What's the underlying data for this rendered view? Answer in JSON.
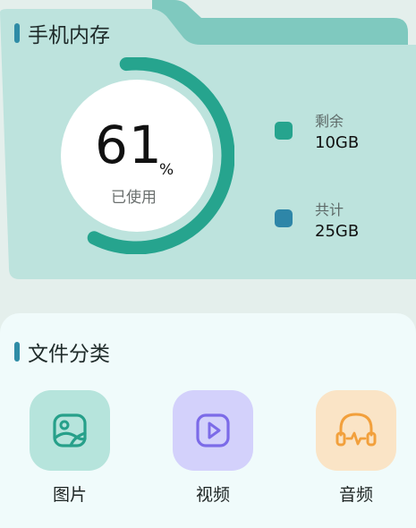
{
  "storage": {
    "title": "手机内存",
    "used_percent": 61,
    "used_value": "61",
    "used_unit": "%",
    "used_caption": "已使用",
    "legend": [
      {
        "label": "剩余",
        "value": "10GB",
        "color": "#26a48e"
      },
      {
        "label": "共计",
        "value": "25GB",
        "color": "#2e86a8"
      }
    ]
  },
  "categories": {
    "title": "文件分类",
    "items": [
      {
        "label": "图片",
        "icon": "image-icon",
        "bg": "#b6e4dc",
        "color": "#27a08a"
      },
      {
        "label": "视频",
        "icon": "video-icon",
        "bg": "#d3d1fb",
        "color": "#7c6be8"
      },
      {
        "label": "音频",
        "icon": "headphones-icon",
        "bg": "#fae4c6",
        "color": "#f2a03c"
      }
    ]
  },
  "colors": {
    "accent": "#2f8ca6",
    "gauge": "#26a48e",
    "folder_back": "#7fc9bf",
    "folder_front": "#bde3dd"
  }
}
